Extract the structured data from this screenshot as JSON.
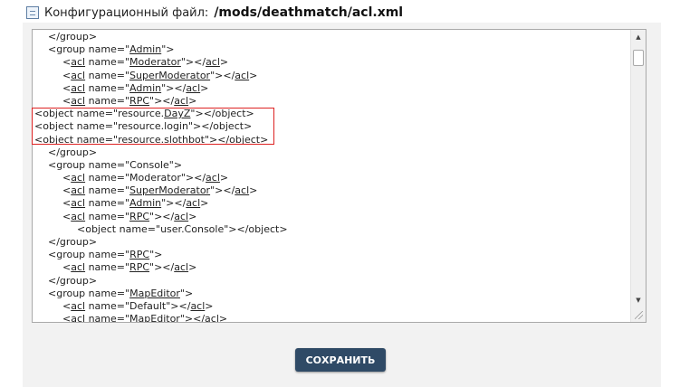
{
  "header": {
    "label": "Конфигурационный файл:",
    "path": "/mods/deathmatch/acl.xml"
  },
  "editor": {
    "lines": [
      {
        "indent": 1,
        "segments": [
          {
            "t": "</group>"
          }
        ]
      },
      {
        "indent": 1,
        "segments": [
          {
            "t": "<group name=\""
          },
          {
            "t": "Admin",
            "u": true
          },
          {
            "t": "\">"
          }
        ]
      },
      {
        "indent": 2,
        "segments": [
          {
            "t": "<"
          },
          {
            "t": "acl",
            "u": true
          },
          {
            "t": " name=\""
          },
          {
            "t": "Moderator",
            "u": true
          },
          {
            "t": "\"></"
          },
          {
            "t": "acl",
            "u": true
          },
          {
            "t": ">"
          }
        ]
      },
      {
        "indent": 2,
        "segments": [
          {
            "t": "<"
          },
          {
            "t": "acl",
            "u": true
          },
          {
            "t": " name=\""
          },
          {
            "t": "SuperModerator",
            "u": true
          },
          {
            "t": "\"></"
          },
          {
            "t": "acl",
            "u": true
          },
          {
            "t": ">"
          }
        ]
      },
      {
        "indent": 2,
        "segments": [
          {
            "t": "<"
          },
          {
            "t": "acl",
            "u": true
          },
          {
            "t": " name=\""
          },
          {
            "t": "Admin",
            "u": true
          },
          {
            "t": "\"></"
          },
          {
            "t": "acl",
            "u": true
          },
          {
            "t": ">"
          }
        ]
      },
      {
        "indent": 2,
        "segments": [
          {
            "t": "<"
          },
          {
            "t": "acl",
            "u": true
          },
          {
            "t": " name=\""
          },
          {
            "t": "RPC",
            "u": true
          },
          {
            "t": "\"></"
          },
          {
            "t": "acl",
            "u": true
          },
          {
            "t": ">"
          }
        ]
      },
      {
        "indent": 0,
        "segments": [
          {
            "t": "<object name=\"resource."
          },
          {
            "t": "DayZ",
            "u": true
          },
          {
            "t": "\"></object>"
          }
        ]
      },
      {
        "indent": 0,
        "segments": [
          {
            "t": "<object name=\"resource.login\"></object>"
          }
        ]
      },
      {
        "indent": 0,
        "segments": [
          {
            "t": "<object name=\"resource."
          },
          {
            "t": "slothbot",
            "u": true
          },
          {
            "t": "\"></object>"
          }
        ]
      },
      {
        "indent": 1,
        "segments": [
          {
            "t": "</group>"
          }
        ]
      },
      {
        "indent": 1,
        "segments": [
          {
            "t": "<group name=\"Console\">"
          }
        ]
      },
      {
        "indent": 2,
        "segments": [
          {
            "t": "<"
          },
          {
            "t": "acl",
            "u": true
          },
          {
            "t": " name=\"Moderator\"></"
          },
          {
            "t": "acl",
            "u": true
          },
          {
            "t": ">"
          }
        ]
      },
      {
        "indent": 2,
        "segments": [
          {
            "t": "<"
          },
          {
            "t": "acl",
            "u": true
          },
          {
            "t": " name=\""
          },
          {
            "t": "SuperModerator",
            "u": true
          },
          {
            "t": "\"></"
          },
          {
            "t": "acl",
            "u": true
          },
          {
            "t": ">"
          }
        ]
      },
      {
        "indent": 2,
        "segments": [
          {
            "t": "<"
          },
          {
            "t": "acl",
            "u": true
          },
          {
            "t": " name=\""
          },
          {
            "t": "Admin",
            "u": true
          },
          {
            "t": "\"></"
          },
          {
            "t": "acl",
            "u": true
          },
          {
            "t": ">"
          }
        ]
      },
      {
        "indent": 2,
        "segments": [
          {
            "t": "<"
          },
          {
            "t": "acl",
            "u": true
          },
          {
            "t": " name=\""
          },
          {
            "t": "RPC",
            "u": true
          },
          {
            "t": "\"></"
          },
          {
            "t": "acl",
            "u": true
          },
          {
            "t": ">"
          }
        ]
      },
      {
        "indent": 3,
        "segments": [
          {
            "t": "<object name=\"user.Console\"></object>"
          }
        ]
      },
      {
        "indent": 1,
        "segments": [
          {
            "t": "</group>"
          }
        ]
      },
      {
        "indent": 1,
        "segments": [
          {
            "t": "<group name=\""
          },
          {
            "t": "RPC",
            "u": true
          },
          {
            "t": "\">"
          }
        ]
      },
      {
        "indent": 2,
        "segments": [
          {
            "t": "<"
          },
          {
            "t": "acl",
            "u": true
          },
          {
            "t": " name=\""
          },
          {
            "t": "RPC",
            "u": true
          },
          {
            "t": "\"></"
          },
          {
            "t": "acl",
            "u": true
          },
          {
            "t": ">"
          }
        ]
      },
      {
        "indent": 1,
        "segments": [
          {
            "t": "</group>"
          }
        ]
      },
      {
        "indent": 1,
        "segments": [
          {
            "t": "<group name=\""
          },
          {
            "t": "MapEditor",
            "u": true
          },
          {
            "t": "\">"
          }
        ]
      },
      {
        "indent": 2,
        "segments": [
          {
            "t": "<"
          },
          {
            "t": "acl",
            "u": true
          },
          {
            "t": " name=\"Default\"></"
          },
          {
            "t": "acl",
            "u": true
          },
          {
            "t": ">"
          }
        ]
      },
      {
        "indent": 2,
        "segments": [
          {
            "t": "<"
          },
          {
            "t": "acl",
            "u": true
          },
          {
            "t": " name=\""
          },
          {
            "t": "MapEditor",
            "u": true
          },
          {
            "t": "\"></"
          },
          {
            "t": "acl",
            "u": true
          },
          {
            "t": ">"
          }
        ]
      }
    ]
  },
  "icons": {
    "file": "config-file-icon",
    "scroll_up": "scroll-up-arrow-icon",
    "scroll_down": "scroll-down-arrow-icon",
    "resize": "resize-grip-icon"
  },
  "colors": {
    "highlight_border": "#dd2222",
    "button_bg": "#2f4a66"
  },
  "save_button": {
    "label": "СОХРАНИТЬ"
  }
}
